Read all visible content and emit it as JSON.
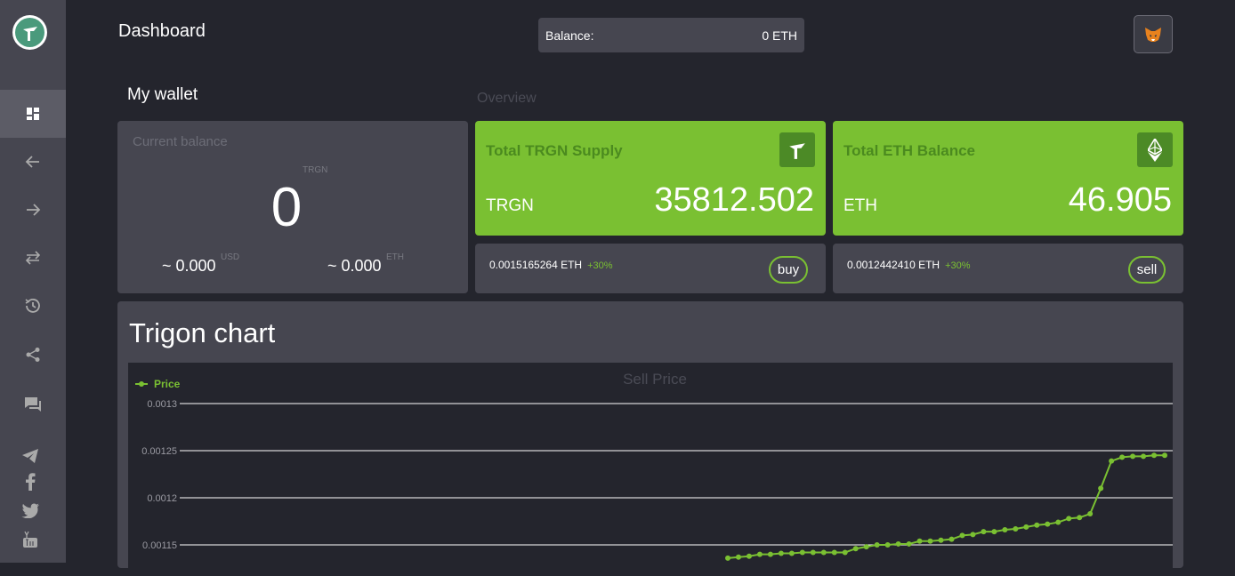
{
  "header": {
    "title": "Dashboard",
    "balance_label": "Balance:",
    "balance_value": "0 ETH"
  },
  "sidebar": {
    "items": [
      {
        "icon": "dashboard-icon",
        "active": true
      },
      {
        "icon": "arrow-left-icon"
      },
      {
        "icon": "arrow-right-icon"
      },
      {
        "icon": "swap-icon"
      },
      {
        "icon": "history-icon"
      },
      {
        "icon": "share-icon"
      },
      {
        "icon": "chat-icon"
      }
    ],
    "social": [
      "telegram-icon",
      "facebook-icon",
      "twitter-icon",
      "youtube-icon"
    ]
  },
  "wallet": {
    "section_title": "My wallet",
    "label": "Current balance",
    "unit": "TRGN",
    "value": "0",
    "usd_value": "~ 0.000",
    "usd_unit": "USD",
    "eth_value": "~ 0.000",
    "eth_unit": "ETH"
  },
  "overview": {
    "title": "Overview",
    "supply": {
      "title": "Total TRGN Supply",
      "unit": "TRGN",
      "value": "35812.502",
      "price": "0.0015165264 ETH",
      "change": "+30%",
      "button": "buy"
    },
    "eth_balance": {
      "title": "Total ETH Balance",
      "unit": "ETH",
      "value": "46.905",
      "price": "0.0012442410 ETH",
      "change": "+30%",
      "button": "sell"
    }
  },
  "chart_section": {
    "heading": "Trigon chart"
  },
  "colors": {
    "accent": "#7ac032",
    "panel": "#464650",
    "background": "#24252d"
  },
  "chart_data": {
    "type": "line",
    "title": "Sell Price",
    "legend": "top-left",
    "grid": true,
    "ylim": [
      0.0011,
      0.0013
    ],
    "y_ticks": [
      "0.0013",
      "0.00125",
      "0.0012",
      "0.00115"
    ],
    "series": [
      {
        "name": "Price",
        "color": "#7ac032",
        "values": [
          0.001136,
          0.001137,
          0.001138,
          0.00114,
          0.00114,
          0.001141,
          0.001141,
          0.001142,
          0.001142,
          0.001142,
          0.001142,
          0.001142,
          0.001146,
          0.001148,
          0.00115,
          0.00115,
          0.001151,
          0.001151,
          0.001154,
          0.001154,
          0.001155,
          0.001156,
          0.00116,
          0.001161,
          0.001164,
          0.001164,
          0.001166,
          0.001167,
          0.001169,
          0.001171,
          0.001172,
          0.001174,
          0.001178,
          0.001179,
          0.001183,
          0.00121,
          0.001239,
          0.001243,
          0.001244,
          0.001244,
          0.001245,
          0.001245
        ]
      }
    ]
  }
}
